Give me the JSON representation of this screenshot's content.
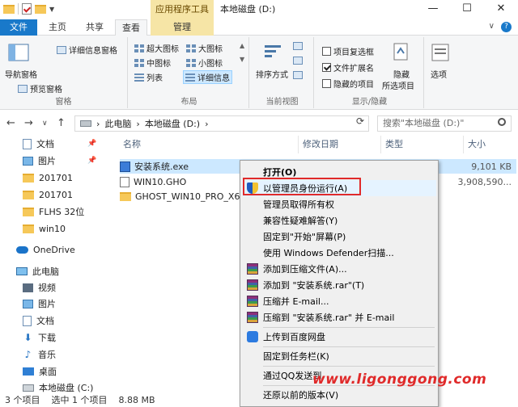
{
  "title_bar": {
    "context_tab_group": "应用程序工具",
    "window_title": "本地磁盘 (D:)",
    "minimize": "—",
    "maximize": "☐",
    "close": "✕"
  },
  "tabs": {
    "file": "文件",
    "home": "主页",
    "share": "共享",
    "view": "查看",
    "manage": "管理"
  },
  "ribbon": {
    "panes": {
      "nav_pane": "导航窗格",
      "preview_pane": "预览窗格",
      "details_pane": "详细信息窗格",
      "label": "窗格"
    },
    "layout": {
      "extra_large": "超大图标",
      "large": "大图标",
      "medium": "中图标",
      "small": "小图标",
      "list": "列表",
      "details": "详细信息",
      "label": "布局"
    },
    "current_view": {
      "sort": "排序方式",
      "label": "当前视图"
    },
    "show_hide": {
      "item_checkbox": "项目复选框",
      "file_ext": "文件扩展名",
      "hidden_items": "隐藏的项目",
      "hide_selected_1": "隐藏",
      "hide_selected_2": "所选项目",
      "label": "显示/隐藏"
    },
    "options": "选项"
  },
  "address": {
    "path_pc": "此电脑",
    "path_drive": "本地磁盘 (D:)",
    "search_placeholder": "搜索\"本地磁盘 (D:)\""
  },
  "nav_pane": {
    "items": [
      {
        "label": "文档"
      },
      {
        "label": "图片"
      },
      {
        "label": "201701"
      },
      {
        "label": "201701"
      },
      {
        "label": "FLHS 32位"
      },
      {
        "label": "win10"
      },
      {
        "label": "OneDrive"
      },
      {
        "label": "此电脑"
      },
      {
        "label": "视频"
      },
      {
        "label": "图片"
      },
      {
        "label": "文档"
      },
      {
        "label": "下载"
      },
      {
        "label": "音乐"
      },
      {
        "label": "桌面"
      },
      {
        "label": "本地磁盘 (C:)"
      }
    ]
  },
  "columns": {
    "name": "名称",
    "modified": "修改日期",
    "type": "类型",
    "size": "大小"
  },
  "files": [
    {
      "name": "安装系统.exe",
      "size": "9,101 KB"
    },
    {
      "name": "WIN10.GHO",
      "size": "3,908,590..."
    },
    {
      "name": "GHOST_WIN10_PRO_X64_",
      "size": ""
    }
  ],
  "status": {
    "count": "3 个项目",
    "selected": "选中 1 个项目",
    "size": "8.88 MB"
  },
  "context_menu": {
    "open": "打开(O)",
    "run_as_admin": "以管理员身份运行(A)",
    "take_ownership": "管理员取得所有权",
    "troubleshoot": "兼容性疑难解答(Y)",
    "pin_start": "固定到\"开始\"屏幕(P)",
    "defender": "使用 Windows Defender扫描...",
    "add_archive": "添加到压缩文件(A)...",
    "add_rar": "添加到 \"安装系统.rar\"(T)",
    "compress_email": "压缩并 E-mail...",
    "compress_rar_email": "压缩到 \"安装系统.rar\" 并 E-mail",
    "baidu": "上传到百度网盘",
    "pin_taskbar": "固定到任务栏(K)",
    "qq_send": "通过QQ发送到",
    "restore": "还原以前的版本(V)"
  },
  "watermark": "www.ligonggong.com"
}
